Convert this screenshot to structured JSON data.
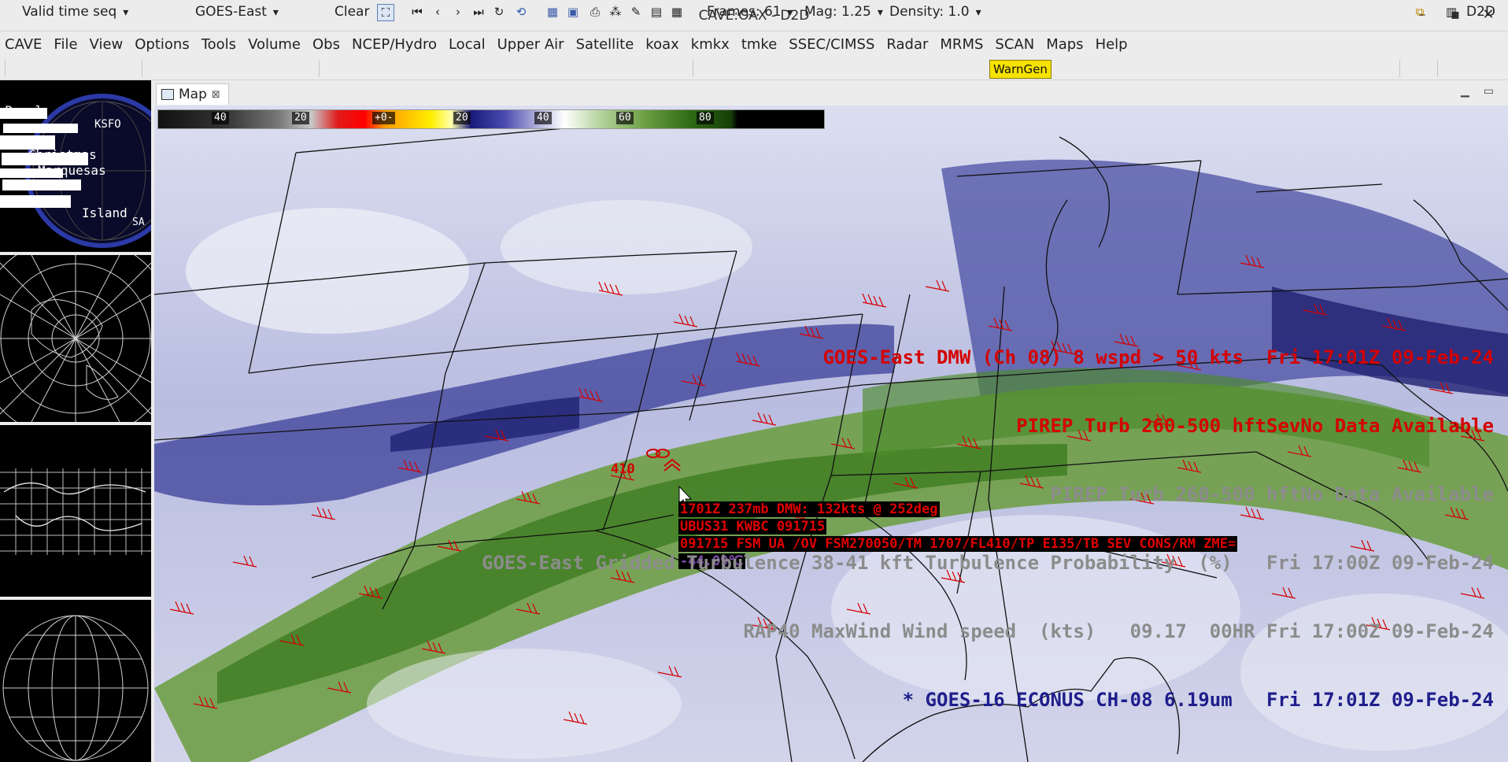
{
  "window": {
    "title": "CAVE:OAX - D2D",
    "minimize": "–",
    "maximize": "▪",
    "close": "✕"
  },
  "menu": [
    "CAVE",
    "File",
    "View",
    "Options",
    "Tools",
    "Volume",
    "Obs",
    "NCEP/Hydro",
    "Local",
    "Upper Air",
    "Satellite",
    "koax",
    "kmkx",
    "tmke",
    "SSEC/CIMSS",
    "Radar",
    "MRMS",
    "SCAN",
    "Maps",
    "Help"
  ],
  "toolbar": {
    "time_mode": "Valid time seq",
    "satellite": "GOES-East",
    "clear": "Clear",
    "frames": "Frames: 61",
    "mag": "Mag: 1.25",
    "density": "Density: 1.0",
    "warngen": "WarnGen",
    "perspective": "D2D"
  },
  "tabs": [
    {
      "label": "Map",
      "close": "⊠"
    }
  ],
  "colorbar": {
    "ticks": [
      "40",
      "20",
      "+0-",
      "20",
      "40",
      "60",
      "80"
    ]
  },
  "inset_labels": [
    "Pearl",
    "KSFO",
    "Christmas",
    "Marquesas",
    "Island",
    "SA"
  ],
  "sample_tooltip": [
    "1701Z 237mb DMW: 132kts @ 252deg",
    "UBUS31 KWBC 091715",
    "091715 FSM UA /OV FSM270050/TM 1707/FL410/TP E135/TB SEV CONS/RM ZME=",
    "-44.09℃"
  ],
  "pirep_flight_level": "410",
  "legend": [
    {
      "text": "GOES-East DMW (Ch 08) 8 wspd > 50 kts  Fri 17:01Z 09-Feb-24",
      "color": "#d40000"
    },
    {
      "text": "PIREP Turb 260-500 hftSevNo Data Available",
      "color": "#d40000"
    },
    {
      "text": "PIREP Turb 260-500 hftNo Data Available",
      "color": "#8c8c8c"
    },
    {
      "text": "GOES-East Gridded Turbulence 38-41 kft Turbulence Probability  (%)   Fri 17:00Z 09-Feb-24",
      "color": "#8c8c8c"
    },
    {
      "text": "RAP40 MaxWind Wind speed  (kts)   09.17  00HR Fri 17:00Z 09-Feb-24",
      "color": "#8c8c8c"
    },
    {
      "text": "* GOES-16 ECONUS CH-08 6.19um   Fri 17:01Z 09-Feb-24",
      "color": "#1e1e8c"
    }
  ],
  "colors": {
    "barb": "#d40000",
    "boundary": "#111111",
    "land_green": "#4f8a2c",
    "moisture_blue": "#2a2a86"
  }
}
